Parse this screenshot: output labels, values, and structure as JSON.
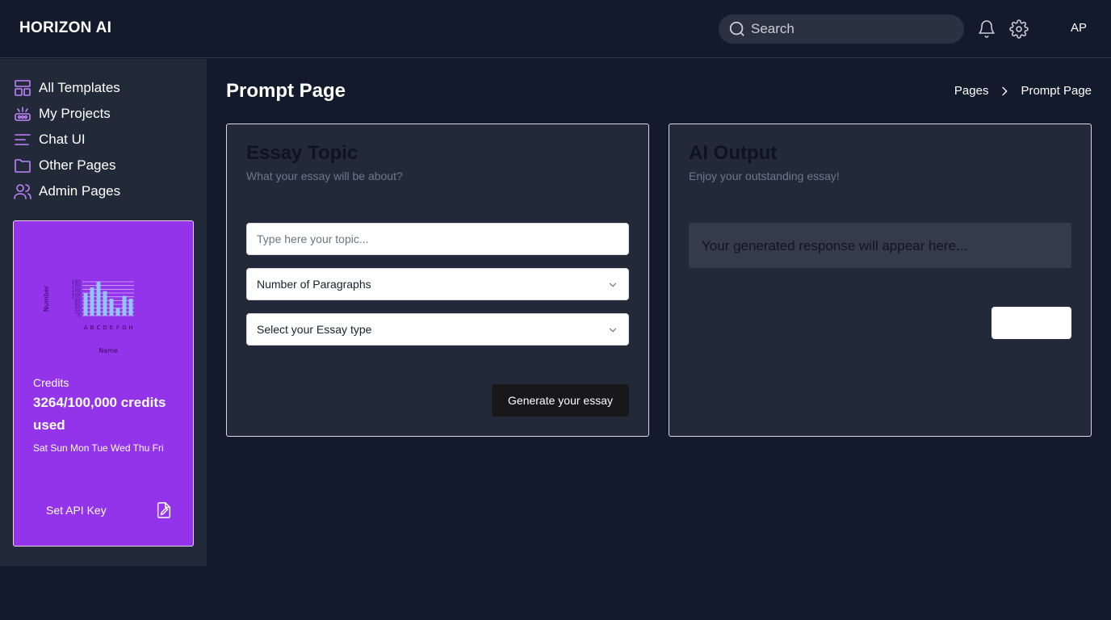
{
  "header": {
    "brand": "HORIZON AI",
    "search_placeholder": "Search",
    "avatar_initials": "AP",
    "icons": [
      "search-icon",
      "bell-icon",
      "gear-icon"
    ]
  },
  "sidebar": {
    "items": [
      {
        "label": "All Templates",
        "icon": "templates-icon"
      },
      {
        "label": "My Projects",
        "icon": "projects-icon"
      },
      {
        "label": "Chat UI",
        "icon": "chat-icon"
      },
      {
        "label": "Other Pages",
        "icon": "folder-icon"
      },
      {
        "label": "Admin Pages",
        "icon": "users-icon"
      }
    ],
    "card": {
      "credits_label": "Credits",
      "credits_used": "3264/100,000 credits used",
      "days": "Sat Sun Mon Tue Wed Thu Fri",
      "api_button_label": "Set API Key",
      "api_icon": "edit-file-icon",
      "accent": "#9333ea"
    }
  },
  "chart_data": {
    "type": "bar",
    "categories": [
      "A",
      "B",
      "C",
      "D",
      "E",
      "F",
      "G",
      "H"
    ],
    "values": [
      120,
      150,
      180,
      130,
      90,
      40,
      105,
      90
    ],
    "xlabel": "Name",
    "ylabel": "Number",
    "ylim": [
      0,
      180
    ],
    "yticks": [
      "0",
      "20",
      "40",
      "60",
      "80",
      "100",
      "120",
      "140",
      "160",
      "180"
    ],
    "grid": true,
    "bar_color": "#93c5fd"
  },
  "main": {
    "page_title": "Prompt Page",
    "breadcrumb": [
      "Pages",
      "Prompt Page"
    ],
    "essay_panel": {
      "title": "Essay Topic",
      "subtitle": "What your essay will be about?",
      "topic_placeholder": "Type here your topic...",
      "paragraphs_select": "Number of Paragraphs",
      "type_select": "Select your Essay type",
      "generate_label": "Generate your essay"
    },
    "output_panel": {
      "title": "AI Output",
      "subtitle": "Enjoy your outstanding essay!",
      "placeholder": "Your generated response will appear here..."
    }
  }
}
